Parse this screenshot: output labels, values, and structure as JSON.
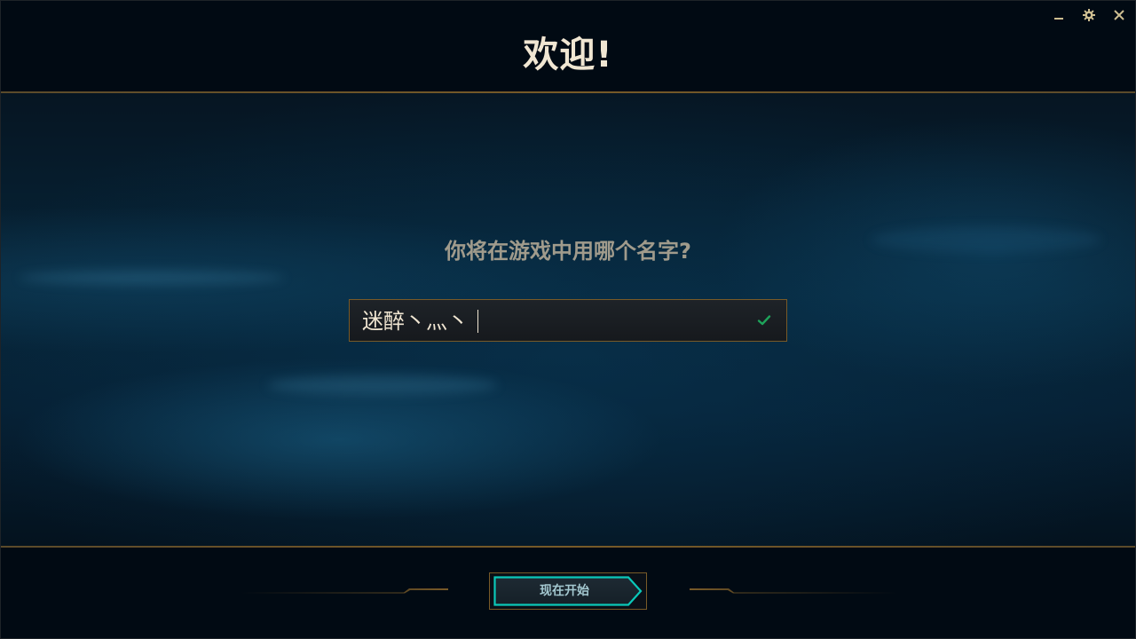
{
  "header": {
    "title": "欢迎!"
  },
  "window_controls": {
    "minimize_icon": "minimize-icon",
    "settings_icon": "gear-icon",
    "close_icon": "close-icon"
  },
  "main": {
    "question": "你将在游戏中用哪个名字?",
    "name_input": {
      "value": "迷醉丶灬丶",
      "valid_icon": "checkmark-icon"
    }
  },
  "footer": {
    "start_button_label": "现在开始"
  },
  "colors": {
    "gold_accent": "#785a28",
    "title_text": "#f0e6d2",
    "question_text": "#a09b8c",
    "check_green": "#1ea35a",
    "button_cyan": "#0ac8b9"
  }
}
